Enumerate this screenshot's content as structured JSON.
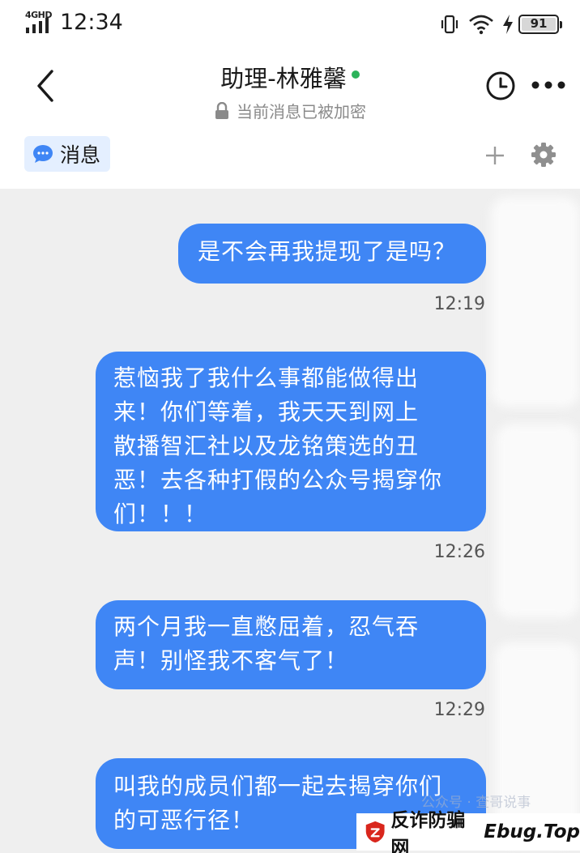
{
  "status_bar": {
    "network": "4GHD",
    "time": "12:34",
    "battery_level": "91"
  },
  "header": {
    "title": "助理-林雅馨",
    "encryption_notice": "当前消息已被加密"
  },
  "subbar": {
    "tab_label": "消息"
  },
  "messages": [
    {
      "text": "是不会再我提现了是吗？",
      "time": "12:19"
    },
    {
      "lines": [
        "惹恼我了我什么事都能做得出",
        "来！你们等着，我天天到网上",
        "散播智汇社以及龙铭策选的丑",
        "恶！去各种打假的公众号揭穿你",
        "们！！！"
      ],
      "time": "12:26"
    },
    {
      "lines": [
        "两个月我一直憋屈着，忍气吞",
        "声！别怪我不客气了！"
      ],
      "time": "12:29"
    },
    {
      "lines": [
        "叫我的成员们都一起去揭穿你们",
        "的可恶行径！"
      ]
    }
  ],
  "watermark": {
    "faint_text": "公众号 · 查哥说事",
    "brand": "反诈防骗网",
    "domain": "Ebug.Top"
  },
  "colors": {
    "bubble": "#3f86f5",
    "online": "#2cb35a",
    "tab_bg": "#e4efff",
    "chat_bg": "#efefef"
  }
}
